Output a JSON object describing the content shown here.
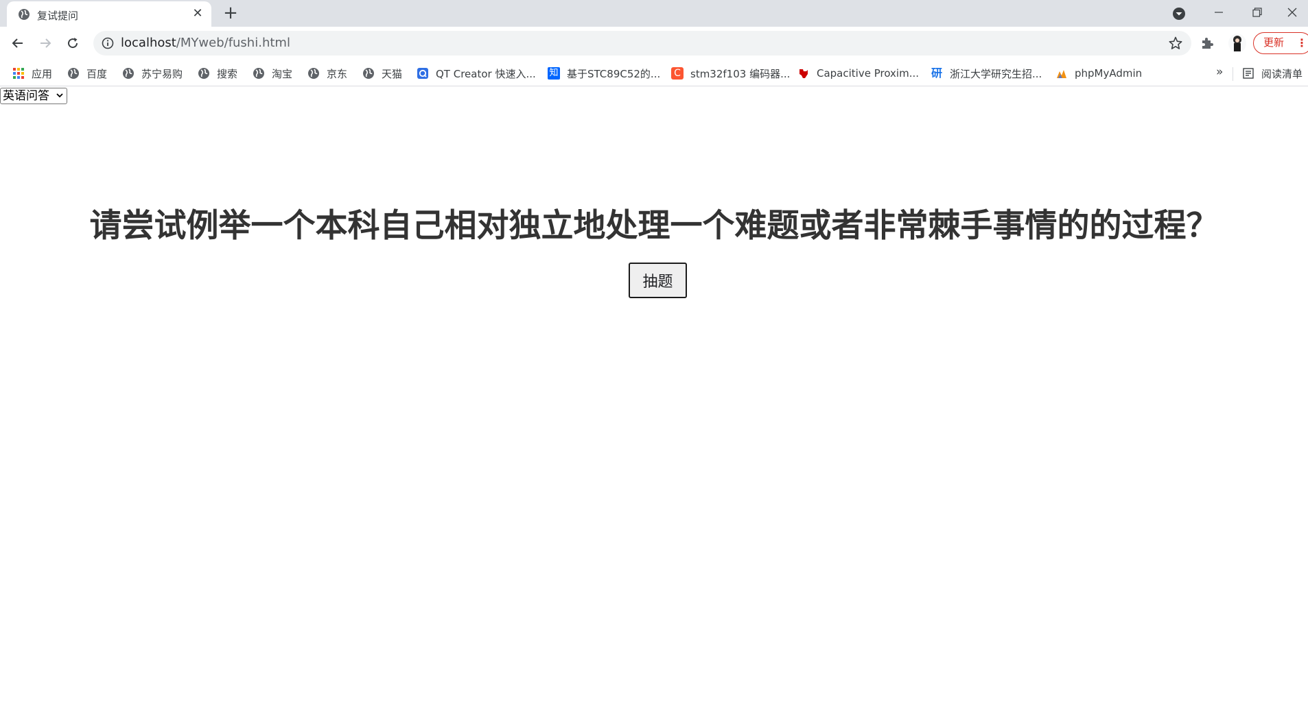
{
  "browser": {
    "tab": {
      "title": "复试提问",
      "close_glyph": "✕",
      "favicon": "globe-icon"
    },
    "new_tab_glyph": "+",
    "address": {
      "host": "localhost",
      "path": "/MYweb/fushi.html"
    },
    "update_label": "更新",
    "menu_glyph": "⋮",
    "bookmarks": [
      {
        "label": "应用",
        "icon": "apps-grid-icon"
      },
      {
        "label": "百度",
        "icon": "globe-icon"
      },
      {
        "label": "苏宁易购",
        "icon": "globe-icon"
      },
      {
        "label": "搜索",
        "icon": "globe-icon"
      },
      {
        "label": "淘宝",
        "icon": "globe-icon"
      },
      {
        "label": "京东",
        "icon": "globe-icon"
      },
      {
        "label": "天猫",
        "icon": "globe-icon"
      },
      {
        "label": "QT Creator 快速入...",
        "icon": "qt-icon"
      },
      {
        "label": "基于STC89C52的...",
        "icon": "zhihu-icon",
        "icon_text": "知"
      },
      {
        "label": "stm32f103 编码器...",
        "icon": "csdn-icon",
        "icon_text": "C"
      },
      {
        "label": "Capacitive Proxim...",
        "icon": "ti-icon"
      },
      {
        "label": "浙江大学研究生招...",
        "icon": "zju-icon",
        "icon_text": "研"
      },
      {
        "label": "phpMyAdmin",
        "icon": "phpmyadmin-icon"
      }
    ],
    "more_glyph": "»",
    "reading_list_label": "阅读清单"
  },
  "page": {
    "category_select": {
      "selected": "英语问答"
    },
    "question": "请尝试例举一个本科自己相对独立地处理一个难题或者非常棘手事情的的过程？",
    "draw_button": "抽题"
  },
  "colors": {
    "tabstrip_bg": "#dee1e6",
    "omnibox_bg": "#f1f3f4",
    "update_red": "#d93025",
    "question_text": "#333333"
  }
}
